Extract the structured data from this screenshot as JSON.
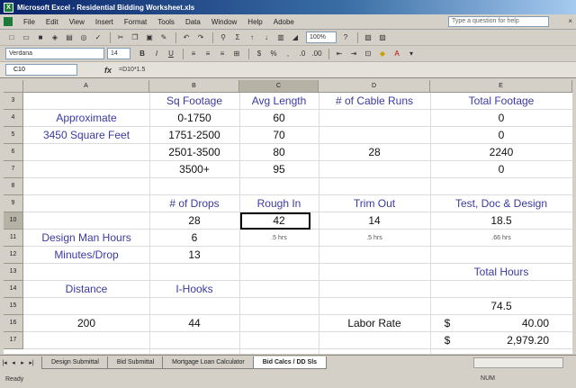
{
  "window": {
    "title": "Microsoft Excel - Residential Bidding Worksheet.xls"
  },
  "menu": [
    "File",
    "Edit",
    "View",
    "Insert",
    "Format",
    "Tools",
    "Data",
    "Window",
    "Help",
    "Adobe"
  ],
  "help_placeholder": "Type a question for help",
  "toolbar": {
    "font": "Verdana",
    "size": "14",
    "zoom": "100%"
  },
  "formula_bar": {
    "name_box": "C10",
    "formula": "=D10*1.5"
  },
  "columns": [
    "A",
    "B",
    "C",
    "D",
    "E"
  ],
  "selected_column": "C",
  "rows": [
    "3",
    "4",
    "5",
    "6",
    "7",
    "8",
    "9",
    "10",
    "11",
    "12",
    "13",
    "14",
    "15",
    "16",
    "17"
  ],
  "selected_row": "10",
  "cells": {
    "B3": "Sq Footage",
    "C3": "Avg Length",
    "D3": "# of Cable Runs",
    "E3": "Total Footage",
    "A4": "Approximate",
    "B4": "0-1750",
    "C4": "60",
    "E4": "0",
    "A5": "3450 Square Feet",
    "B5": "1751-2500",
    "C5": "70",
    "E5": "0",
    "B6": "2501-3500",
    "C6": "80",
    "D6": "28",
    "E6": "2240",
    "B7": "3500+",
    "C7": "95",
    "E7": "0",
    "B9": "# of Drops",
    "C9": "Rough In",
    "D9": "Trim Out",
    "E9": "Test, Doc & Design",
    "B10": "28",
    "C10": "42",
    "D10": "14",
    "E10": "18.5",
    "A11": "Design Man Hours",
    "B11": "6",
    "C11": ".5 hrs",
    "D11": ".5 hrs",
    "E11": ".66 hrs",
    "A12": "Minutes/Drop",
    "B12": "13",
    "E13": "Total Hours",
    "A14": "Distance",
    "B14": "I-Hooks",
    "E15": "74.5",
    "A16": "200",
    "B16": "44",
    "D16": "Labor Rate",
    "E16s": "$",
    "E16": "40.00",
    "E17s": "$",
    "E17": "2,979.20"
  },
  "sheet_tabs": [
    "Design Submittal",
    "Bid Submittal",
    "Mortgage Loan Calculator",
    "Bid Calcs / DD Sls"
  ],
  "active_tab": 3,
  "status": {
    "left": "Ready",
    "right": "NUM"
  }
}
